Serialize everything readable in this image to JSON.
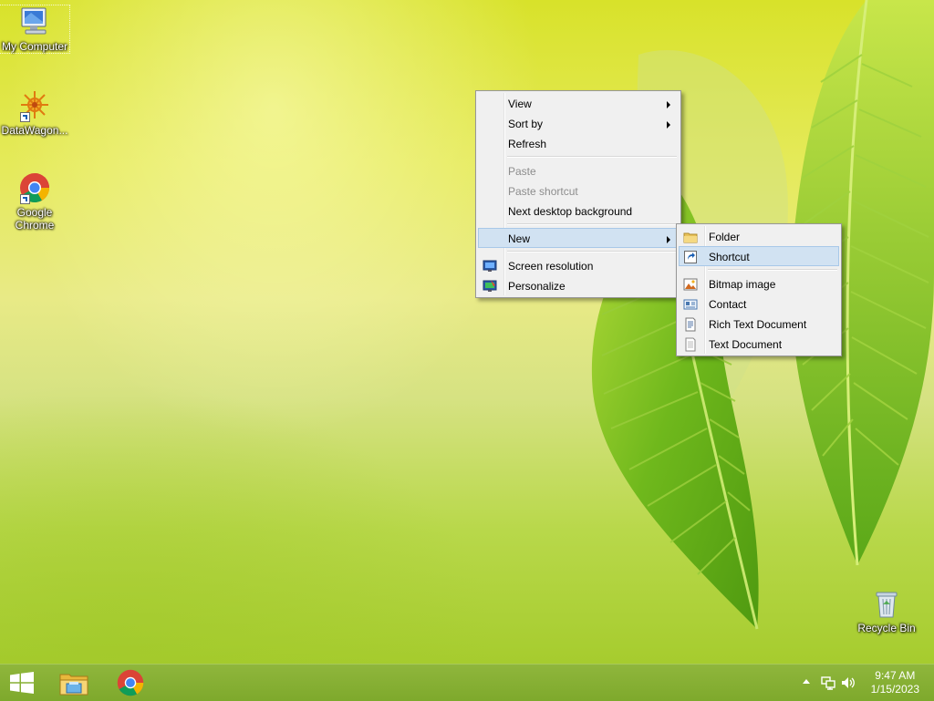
{
  "desktop": {
    "icons": [
      {
        "label": "My Computer",
        "icon": "computer-icon"
      },
      {
        "label": "DataWagon...",
        "icon": "datawagon-icon"
      },
      {
        "label": "Google Chrome",
        "icon": "chrome-icon"
      },
      {
        "label": "Recycle Bin",
        "icon": "recycle-bin-icon"
      }
    ]
  },
  "context_menu": {
    "items": [
      {
        "label": "View",
        "submenu": true
      },
      {
        "label": "Sort by",
        "submenu": true
      },
      {
        "label": "Refresh"
      },
      {
        "label": "Paste",
        "disabled": true
      },
      {
        "label": "Paste shortcut",
        "disabled": true
      },
      {
        "label": "Next desktop background"
      },
      {
        "label": "New",
        "submenu": true,
        "highlighted": true
      },
      {
        "label": "Screen resolution",
        "icon": "screen-resolution-icon"
      },
      {
        "label": "Personalize",
        "icon": "personalize-icon"
      }
    ]
  },
  "new_submenu": {
    "items": [
      {
        "label": "Folder",
        "icon": "folder-icon"
      },
      {
        "label": "Shortcut",
        "icon": "shortcut-icon",
        "highlighted": true
      },
      {
        "label": "Bitmap image",
        "icon": "bitmap-icon"
      },
      {
        "label": "Contact",
        "icon": "contact-icon"
      },
      {
        "label": "Rich Text Document",
        "icon": "rich-text-icon"
      },
      {
        "label": "Text Document",
        "icon": "text-document-icon"
      }
    ]
  },
  "taskbar": {
    "pinned": [
      {
        "icon": "windows-start-icon"
      },
      {
        "icon": "file-explorer-icon"
      },
      {
        "icon": "chrome-icon"
      }
    ],
    "tray": {
      "time": "9:47 AM",
      "date": "1/15/2023",
      "icons": [
        "show-hidden-icons-icon",
        "network-icon",
        "volume-icon"
      ]
    }
  },
  "colors": {
    "menu_bg": "#f0f0f0",
    "menu_highlight": "#d1e2f2",
    "taskbar": "#7ea92c"
  }
}
